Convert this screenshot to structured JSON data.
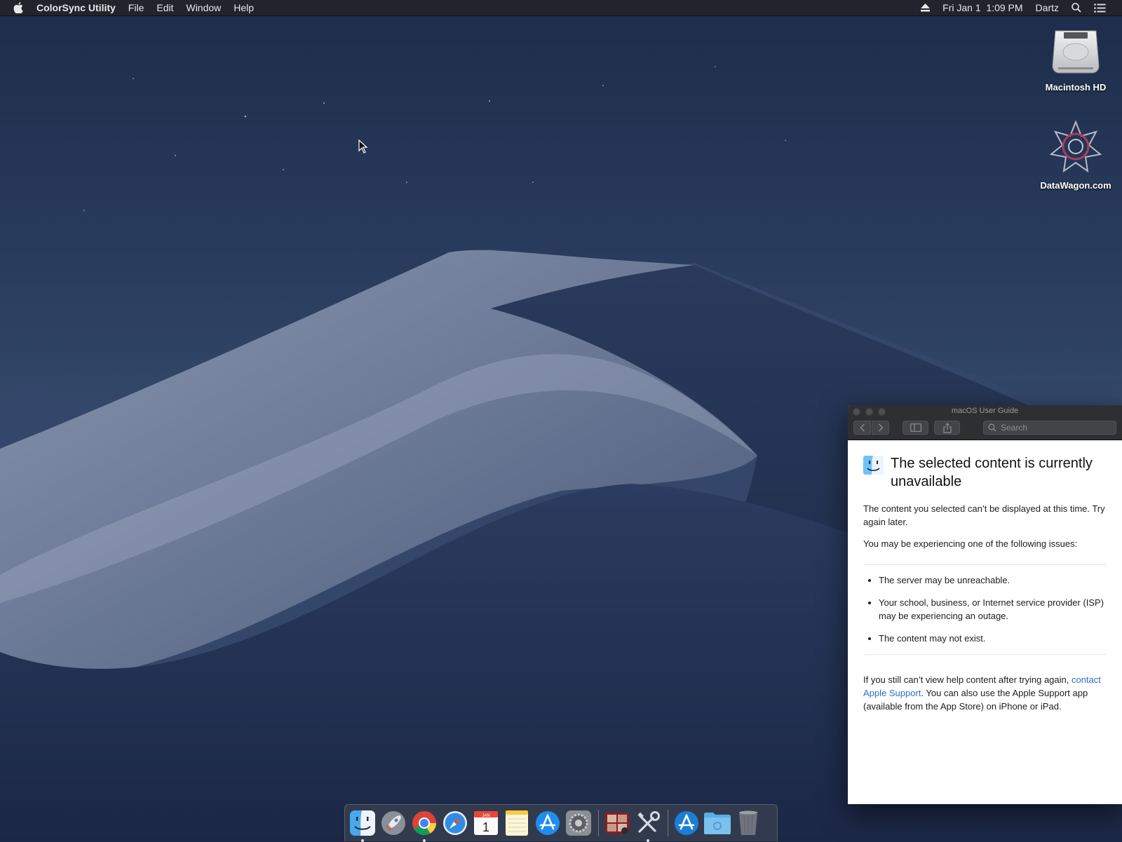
{
  "menubar": {
    "apple_icon": "apple-icon",
    "app_name": "ColorSync Utility",
    "menus": [
      "File",
      "Edit",
      "Window",
      "Help"
    ],
    "eject_icon": "eject-icon",
    "clock": "Fri Jan 1  1:09 PM",
    "user": "Dartz",
    "spotlight_icon": "magnifier-icon",
    "notification_icon": "list-icon"
  },
  "desktop": {
    "icons": [
      {
        "label": "Macintosh HD",
        "icon": "hard-drive-icon"
      },
      {
        "label": "DataWagon.com",
        "icon": "network-volume-icon"
      }
    ]
  },
  "help_window": {
    "title": "macOS User Guide",
    "search_placeholder": "Search",
    "heading": "The selected content is currently unavailable",
    "intro": "The content you selected can’t be displayed at this time. Try again later.",
    "issues_lead": "You may be experiencing one of the following issues:",
    "issues": [
      "The server may be unreachable.",
      "Your school, business, or Internet service provider (ISP) may be experiencing an outage.",
      "The content may not exist."
    ],
    "footer_before": "If you still can’t view help content after trying again, ",
    "footer_link": "contact Apple Support",
    "footer_after": ". You can also use the Apple Support app (available from the App Store) on iPhone or iPad.",
    "link_color": "#2f6dd0"
  },
  "dock": {
    "apps": [
      {
        "name": "Finder",
        "running": true
      },
      {
        "name": "Launchpad",
        "running": false
      },
      {
        "name": "Google Chrome",
        "running": true
      },
      {
        "name": "Safari",
        "running": false
      },
      {
        "name": "Calendar",
        "running": false,
        "badge_month": "JAN",
        "badge_day": "1"
      },
      {
        "name": "Notes",
        "running": false
      },
      {
        "name": "App Store",
        "running": false
      },
      {
        "name": "System Preferences",
        "running": false
      },
      {
        "name": "Photo Booth",
        "running": false
      },
      {
        "name": "Utilities",
        "running": true
      }
    ],
    "others": [
      {
        "name": "App Store Downloads"
      },
      {
        "name": "Documents Folder"
      },
      {
        "name": "Trash"
      }
    ]
  }
}
